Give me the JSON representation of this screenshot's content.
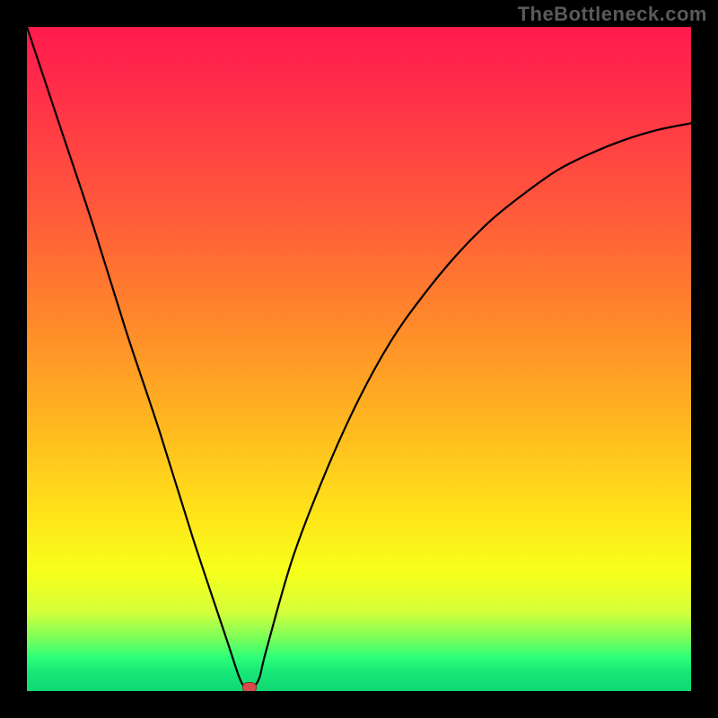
{
  "watermark": "TheBottleneck.com",
  "chart_data": {
    "type": "line",
    "title": "",
    "xlabel": "",
    "ylabel": "",
    "xlim": [
      0,
      100
    ],
    "ylim": [
      0,
      100
    ],
    "grid": false,
    "series": [
      {
        "name": "curve",
        "x": [
          0,
          5,
          10,
          15,
          20,
          25,
          30,
          32,
          33,
          34,
          35,
          36,
          40,
          45,
          50,
          55,
          60,
          65,
          70,
          75,
          80,
          85,
          90,
          95,
          100
        ],
        "values": [
          100,
          85,
          70,
          54,
          39,
          23,
          8,
          2,
          0.5,
          0.5,
          2,
          6,
          20,
          33,
          44,
          53,
          60,
          66,
          71,
          75,
          78.5,
          81,
          83,
          84.5,
          85.5
        ]
      }
    ],
    "marker": {
      "x": 33.5,
      "y": 0.5,
      "color": "#d84a4a"
    },
    "background_gradient": {
      "stops": [
        {
          "pos": 0,
          "color": "#ff1a4d"
        },
        {
          "pos": 45,
          "color": "#ff8a2a"
        },
        {
          "pos": 74,
          "color": "#ffe61a"
        },
        {
          "pos": 92,
          "color": "#7bff5a"
        },
        {
          "pos": 100,
          "color": "#11d773"
        }
      ]
    }
  }
}
